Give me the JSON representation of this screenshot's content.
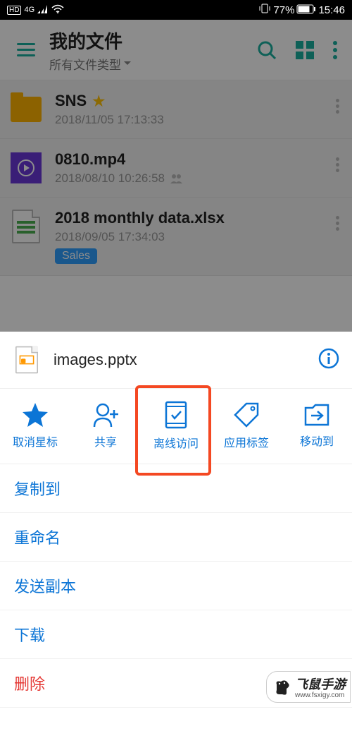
{
  "status": {
    "hd": "HD",
    "net": "4G",
    "battery_pct": "77%",
    "time": "15:46"
  },
  "appbar": {
    "title": "我的文件",
    "subtitle": "所有文件类型"
  },
  "files": [
    {
      "name": "SNS",
      "date": "2018/11/05 17:13:33",
      "starred": true,
      "kind": "folder"
    },
    {
      "name": "0810.mp4",
      "date": "2018/08/10 10:26:58",
      "shared": true,
      "kind": "video"
    },
    {
      "name": "2018 monthly data.xlsx",
      "date": "2018/09/05 17:34:03",
      "tag": "Sales",
      "kind": "xlsx"
    }
  ],
  "sheet": {
    "file": "images.pptx",
    "actions": {
      "unstar": "取消星标",
      "share": "共享",
      "offline": "离线访问",
      "tag": "应用标签",
      "move": "移动到"
    },
    "menu": {
      "copy_to": "复制到",
      "rename": "重命名",
      "send_copy": "发送副本",
      "download": "下载",
      "delete": "删除"
    }
  },
  "watermark": {
    "brand": "飞鼠手游",
    "url": "www.fsxigy.com"
  },
  "colors": {
    "accent": "#1AAF9E",
    "link": "#0C75D6",
    "highlight": "#F44822",
    "danger": "#E53935"
  }
}
